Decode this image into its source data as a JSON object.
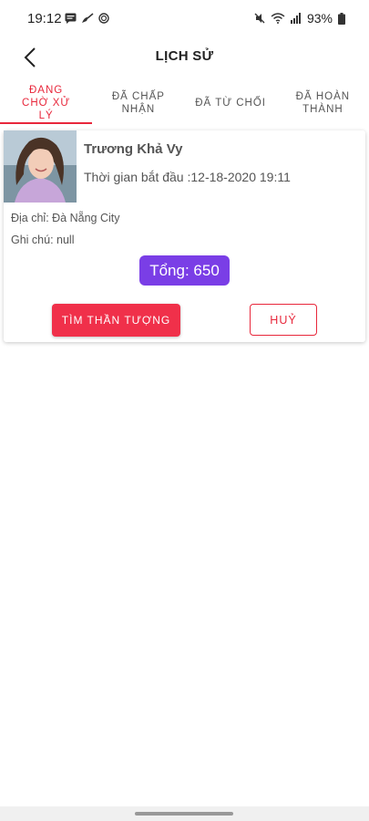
{
  "status_bar": {
    "time": "19:12",
    "battery": "93%",
    "left_icons": [
      "message-icon",
      "broom-icon",
      "target-icon"
    ],
    "right_icons": [
      "mute-icon",
      "wifi-icon",
      "signal-icon",
      "battery-icon"
    ]
  },
  "header": {
    "title": "LỊCH SỬ",
    "back_icon": "chevron-left-icon"
  },
  "tabs": [
    {
      "label": "ĐANG CHỜ XỬ LÝ",
      "active": true
    },
    {
      "label": "ĐÃ CHẤP NHẬN",
      "active": false
    },
    {
      "label": "ĐÃ TỪ CHỐI",
      "active": false
    },
    {
      "label": "ĐÃ HOÀN THÀNH",
      "active": false
    }
  ],
  "booking": {
    "name": "Trương Khả Vy",
    "start_time": "Thời gian bắt đầu :12-18-2020 19:11",
    "address": "Địa chỉ: Đà Nẵng City",
    "note": "Ghi chú: null",
    "total": "Tổng: 650",
    "find_button": "TÌM THẦN TƯỢNG",
    "cancel_button": "HUỶ"
  },
  "colors": {
    "accent_red": "#e8273b",
    "button_red": "#f0304a",
    "total_purple": "#7a3ee6"
  }
}
